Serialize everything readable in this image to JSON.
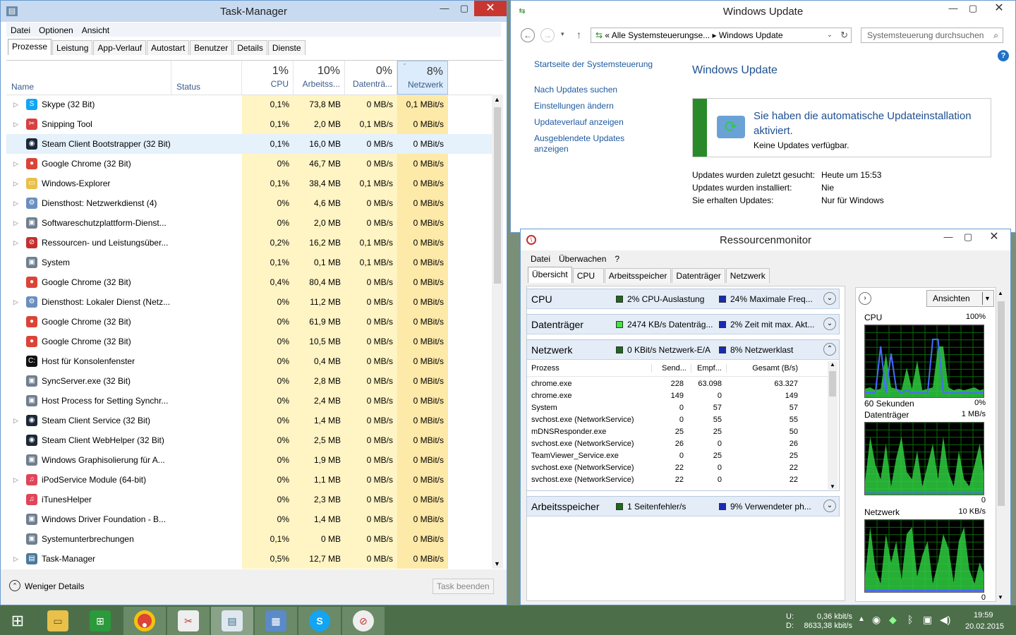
{
  "taskmanager": {
    "title": "Task-Manager",
    "menu": [
      "Datei",
      "Optionen",
      "Ansicht"
    ],
    "tabs": [
      "Prozesse",
      "Leistung",
      "App-Verlauf",
      "Autostart",
      "Benutzer",
      "Details",
      "Dienste"
    ],
    "columns": {
      "name": "Name",
      "status": "Status",
      "cpu_pct": "1%",
      "cpu": "CPU",
      "mem_pct": "10%",
      "mem": "Arbeitss...",
      "disk_pct": "0%",
      "disk": "Datenträ...",
      "net_pct": "8%",
      "net": "Netzwerk"
    },
    "rows": [
      {
        "name": "Skype (32 Bit)",
        "exp": true,
        "icon": "skype-icon",
        "color": "#12a5f4",
        "glyph": "S",
        "cpu": "0,1%",
        "mem": "73,8 MB",
        "disk": "0 MB/s",
        "net": "0,1 MBit/s"
      },
      {
        "name": "Snipping Tool",
        "exp": true,
        "icon": "scissors-icon",
        "color": "#d94040",
        "glyph": "✂",
        "cpu": "0,1%",
        "mem": "2,0 MB",
        "disk": "0,1 MB/s",
        "net": "0 MBit/s"
      },
      {
        "name": "Steam Client Bootstrapper (32 Bit)",
        "exp": false,
        "icon": "steam-icon",
        "color": "#1b2838",
        "glyph": "◉",
        "cpu": "0,1%",
        "mem": "16,0 MB",
        "disk": "0 MB/s",
        "net": "0 MBit/s",
        "selected": true
      },
      {
        "name": "Google Chrome (32 Bit)",
        "exp": true,
        "icon": "chrome-icon",
        "color": "#db4437",
        "glyph": "●",
        "cpu": "0%",
        "mem": "46,7 MB",
        "disk": "0 MB/s",
        "net": "0 MBit/s"
      },
      {
        "name": "Windows-Explorer",
        "exp": true,
        "icon": "folder-icon",
        "color": "#e8c04a",
        "glyph": "▭",
        "cpu": "0,1%",
        "mem": "38,4 MB",
        "disk": "0,1 MB/s",
        "net": "0 MBit/s"
      },
      {
        "name": "Diensthost: Netzwerkdienst (4)",
        "exp": true,
        "icon": "gear-icon",
        "color": "#6a8fbf",
        "glyph": "⚙",
        "cpu": "0%",
        "mem": "4,6 MB",
        "disk": "0 MB/s",
        "net": "0 MBit/s"
      },
      {
        "name": "Softwareschutzplattform-Dienst...",
        "exp": true,
        "icon": "window-icon",
        "color": "#6f7f8f",
        "glyph": "▣",
        "cpu": "0%",
        "mem": "2,0 MB",
        "disk": "0 MB/s",
        "net": "0 MBit/s"
      },
      {
        "name": "Ressourcen- und Leistungsüber...",
        "exp": true,
        "icon": "resmon-icon",
        "color": "#c43030",
        "glyph": "⊘",
        "cpu": "0,2%",
        "mem": "16,2 MB",
        "disk": "0,1 MB/s",
        "net": "0 MBit/s"
      },
      {
        "name": "System",
        "exp": false,
        "icon": "window-icon",
        "color": "#6f7f8f",
        "glyph": "▣",
        "cpu": "0,1%",
        "mem": "0,1 MB",
        "disk": "0,1 MB/s",
        "net": "0 MBit/s"
      },
      {
        "name": "Google Chrome (32 Bit)",
        "exp": false,
        "icon": "chrome-icon",
        "color": "#db4437",
        "glyph": "●",
        "cpu": "0,4%",
        "mem": "80,4 MB",
        "disk": "0 MB/s",
        "net": "0 MBit/s"
      },
      {
        "name": "Diensthost: Lokaler Dienst (Netz...",
        "exp": true,
        "icon": "gear-icon",
        "color": "#6a8fbf",
        "glyph": "⚙",
        "cpu": "0%",
        "mem": "11,2 MB",
        "disk": "0 MB/s",
        "net": "0 MBit/s"
      },
      {
        "name": "Google Chrome (32 Bit)",
        "exp": false,
        "icon": "chrome-icon",
        "color": "#db4437",
        "glyph": "●",
        "cpu": "0%",
        "mem": "61,9 MB",
        "disk": "0 MB/s",
        "net": "0 MBit/s"
      },
      {
        "name": "Google Chrome (32 Bit)",
        "exp": false,
        "icon": "chrome-icon",
        "color": "#db4437",
        "glyph": "●",
        "cpu": "0%",
        "mem": "10,5 MB",
        "disk": "0 MB/s",
        "net": "0 MBit/s"
      },
      {
        "name": "Host für Konsolenfenster",
        "exp": false,
        "icon": "console-icon",
        "color": "#111",
        "glyph": "C:",
        "cpu": "0%",
        "mem": "0,4 MB",
        "disk": "0 MB/s",
        "net": "0 MBit/s"
      },
      {
        "name": "SyncServer.exe (32 Bit)",
        "exp": false,
        "icon": "window-icon",
        "color": "#6f7f8f",
        "glyph": "▣",
        "cpu": "0%",
        "mem": "2,8 MB",
        "disk": "0 MB/s",
        "net": "0 MBit/s"
      },
      {
        "name": "Host Process for Setting Synchr...",
        "exp": false,
        "icon": "window-icon",
        "color": "#6f7f8f",
        "glyph": "▣",
        "cpu": "0%",
        "mem": "2,4 MB",
        "disk": "0 MB/s",
        "net": "0 MBit/s"
      },
      {
        "name": "Steam Client Service (32 Bit)",
        "exp": true,
        "icon": "steam-icon",
        "color": "#1b2838",
        "glyph": "◉",
        "cpu": "0%",
        "mem": "1,4 MB",
        "disk": "0 MB/s",
        "net": "0 MBit/s"
      },
      {
        "name": "Steam Client WebHelper (32 Bit)",
        "exp": false,
        "icon": "steam-icon",
        "color": "#1b2838",
        "glyph": "◉",
        "cpu": "0%",
        "mem": "2,5 MB",
        "disk": "0 MB/s",
        "net": "0 MBit/s"
      },
      {
        "name": "Windows Graphisolierung für A...",
        "exp": false,
        "icon": "window-icon",
        "color": "#6f7f8f",
        "glyph": "▣",
        "cpu": "0%",
        "mem": "1,9 MB",
        "disk": "0 MB/s",
        "net": "0 MBit/s"
      },
      {
        "name": "iPodService Module (64-bit)",
        "exp": true,
        "icon": "itunes-icon",
        "color": "#e0455a",
        "glyph": "♫",
        "cpu": "0%",
        "mem": "1,1 MB",
        "disk": "0 MB/s",
        "net": "0 MBit/s"
      },
      {
        "name": "iTunesHelper",
        "exp": false,
        "icon": "itunes-icon",
        "color": "#e0455a",
        "glyph": "♫",
        "cpu": "0%",
        "mem": "2,3 MB",
        "disk": "0 MB/s",
        "net": "0 MBit/s"
      },
      {
        "name": "Windows Driver Foundation - B...",
        "exp": false,
        "icon": "window-icon",
        "color": "#6f7f8f",
        "glyph": "▣",
        "cpu": "0%",
        "mem": "1,4 MB",
        "disk": "0 MB/s",
        "net": "0 MBit/s"
      },
      {
        "name": "Systemunterbrechungen",
        "exp": false,
        "icon": "window-icon",
        "color": "#6f7f8f",
        "glyph": "▣",
        "cpu": "0,1%",
        "mem": "0 MB",
        "disk": "0 MB/s",
        "net": "0 MBit/s"
      },
      {
        "name": "Task-Manager",
        "exp": true,
        "icon": "taskmgr-icon",
        "color": "#4a7a9a",
        "glyph": "▤",
        "cpu": "0,5%",
        "mem": "12,7 MB",
        "disk": "0 MB/s",
        "net": "0 MBit/s"
      }
    ],
    "fewer_details": "Weniger Details",
    "end_task": "Task beenden"
  },
  "windowsupdate": {
    "title": "Windows Update",
    "address": "« Alle Systemsteuerungse... ▸ Windows Update",
    "search_placeholder": "Systemsteuerung durchsuchen",
    "side_links": [
      "Startseite der Systemsteuerung",
      "Nach Updates suchen",
      "Einstellungen ändern",
      "Updateverlauf anzeigen",
      "Ausgeblendete Updates anzeigen"
    ],
    "heading": "Windows Update",
    "status_title": "Sie haben die automatische Updateinstallation aktiviert.",
    "status_sub": "Keine Updates verfügbar.",
    "info": [
      {
        "k": "Updates wurden zuletzt gesucht:",
        "v": "Heute um 15:53"
      },
      {
        "k": "Updates wurden installiert:",
        "v": "Nie"
      },
      {
        "k": "Sie erhalten Updates:",
        "v": "Nur für Windows"
      }
    ]
  },
  "resmon": {
    "title": "Ressourcenmonitor",
    "menu": [
      "Datei",
      "Überwachen",
      "?"
    ],
    "tabs": [
      "Übersicht",
      "CPU",
      "Arbeitsspeicher",
      "Datenträger",
      "Netzwerk"
    ],
    "panels": [
      {
        "name": "CPU",
        "s1": "2% CPU-Auslastung",
        "c1": "#1a6b1a",
        "s2": "24% Maximale Freq...",
        "c2": "#1a2bb0",
        "chev": "⌄"
      },
      {
        "name": "Datenträger",
        "s1": "2474 KB/s Datenträg...",
        "c1": "#3ee63e",
        "s2": "2% Zeit mit max. Akt...",
        "c2": "#1a2bb0",
        "chev": "⌄"
      },
      {
        "name": "Netzwerk",
        "s1": "0 KBit/s Netzwerk-E/A",
        "c1": "#1a6b1a",
        "s2": "8% Netzwerklast",
        "c2": "#1a2bb0",
        "chev": "⌃"
      },
      {
        "name": "Arbeitsspeicher",
        "s1": "1 Seitenfehler/s",
        "c1": "#1a6b1a",
        "s2": "9% Verwendeter ph...",
        "c2": "#1a2bb0",
        "chev": "⌄"
      }
    ],
    "net_cols": [
      "Prozess",
      "Send...",
      "Empf...",
      "Gesamt (B/s)"
    ],
    "net_rows": [
      [
        "chrome.exe",
        "228",
        "63.098",
        "63.327"
      ],
      [
        "chrome.exe",
        "149",
        "0",
        "149"
      ],
      [
        "System",
        "0",
        "57",
        "57"
      ],
      [
        "svchost.exe (NetworkService)",
        "0",
        "55",
        "55"
      ],
      [
        "mDNSResponder.exe",
        "25",
        "25",
        "50"
      ],
      [
        "svchost.exe (NetworkService)",
        "26",
        "0",
        "26"
      ],
      [
        "TeamViewer_Service.exe",
        "0",
        "25",
        "25"
      ],
      [
        "svchost.exe (NetworkService)",
        "22",
        "0",
        "22"
      ],
      [
        "svchost.exe (NetworkService)",
        "22",
        "0",
        "22"
      ]
    ],
    "views_btn": "Ansichten",
    "graphs": [
      {
        "label": "CPU",
        "max": "100%",
        "foot_l": "60 Sekunden",
        "foot_r": "0%"
      },
      {
        "label": "Datenträger",
        "max": "1 MB/s",
        "foot_l": "",
        "foot_r": "0"
      },
      {
        "label": "Netzwerk",
        "max": "10 KB/s",
        "foot_l": "",
        "foot_r": "0"
      }
    ]
  },
  "taskbar": {
    "net_u_label": "U:",
    "net_u": "0,36 kbit/s",
    "net_d_label": "D:",
    "net_d": "8633,38 kbit/s",
    "time": "19:59",
    "date": "20.02.2015"
  }
}
